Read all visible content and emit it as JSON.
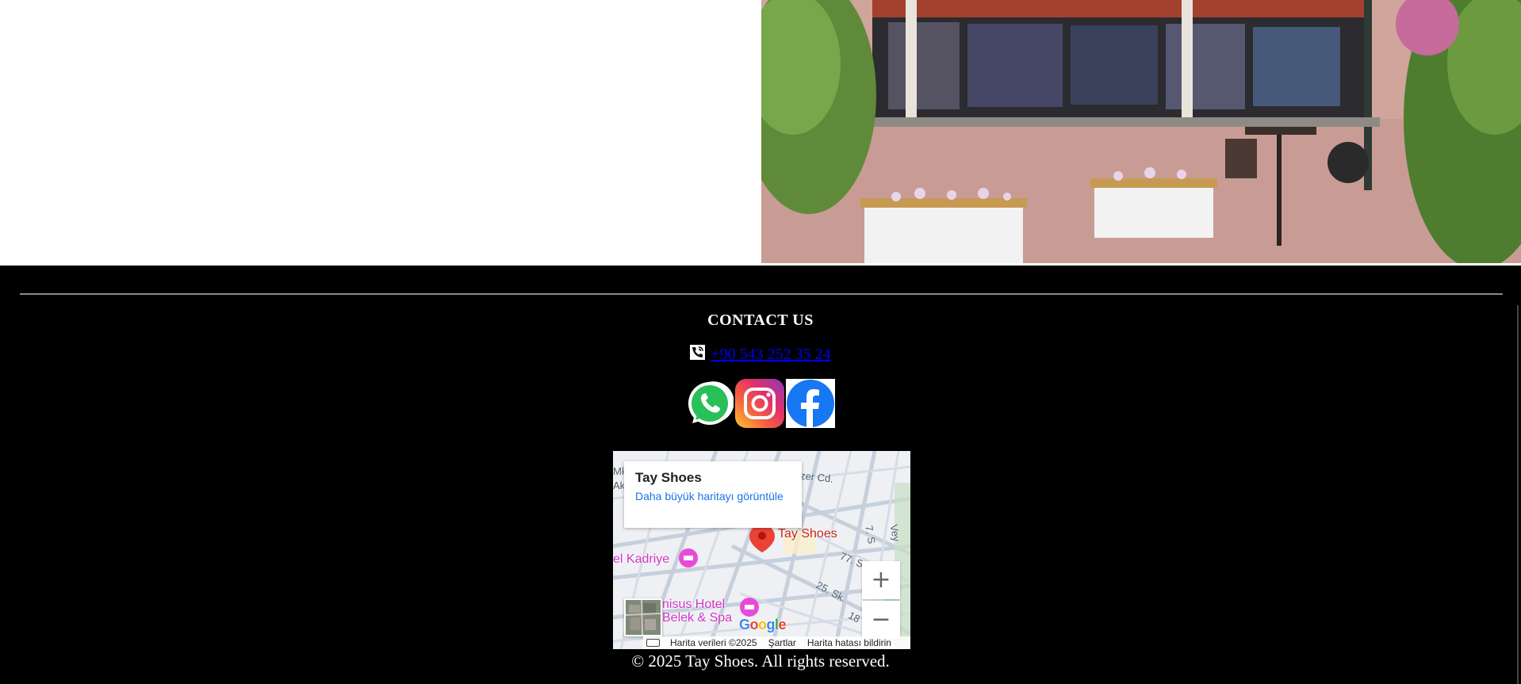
{
  "footer": {
    "contact_heading": "CONTACT US",
    "phone_text": "+90 543 252 35 24",
    "social": [
      {
        "name": "WhatsApp",
        "icon": "whatsapp-icon",
        "color": "#25d366"
      },
      {
        "name": "Instagram",
        "icon": "instagram-icon",
        "color": "#e1306c"
      },
      {
        "name": "Facebook",
        "icon": "facebook-icon",
        "color": "#1877f2"
      }
    ],
    "copyright": "© 2025 Tay Shoes. All rights reserved."
  },
  "map": {
    "place_title": "Tay Shoes",
    "larger_map_link": "Daha büyük haritayı görüntüle",
    "pin_label": "Tay Shoes",
    "hotel_1": "el Kadriye",
    "hotel_2": "nisus Hotel Belek & Spa",
    "street_ozer": "Özer Cd.",
    "street_77": "77. S",
    "street_25": "25. Sk.",
    "street_18": "18",
    "street_7": "7. S",
    "street_vey": "Vey",
    "label_ak": "Ak",
    "label_mk": "Mk",
    "zoom_in": "+",
    "zoom_out": "−",
    "attribution_data": "Harita verileri ©2025",
    "attribution_terms": "Şartlar",
    "attribution_report": "Harita hatası bildirin",
    "google_logo": "Google"
  },
  "colors": {
    "footer_bg": "#000000",
    "link": "#0000ee",
    "pin": "#ea4335",
    "hotel": "#d034c5"
  }
}
